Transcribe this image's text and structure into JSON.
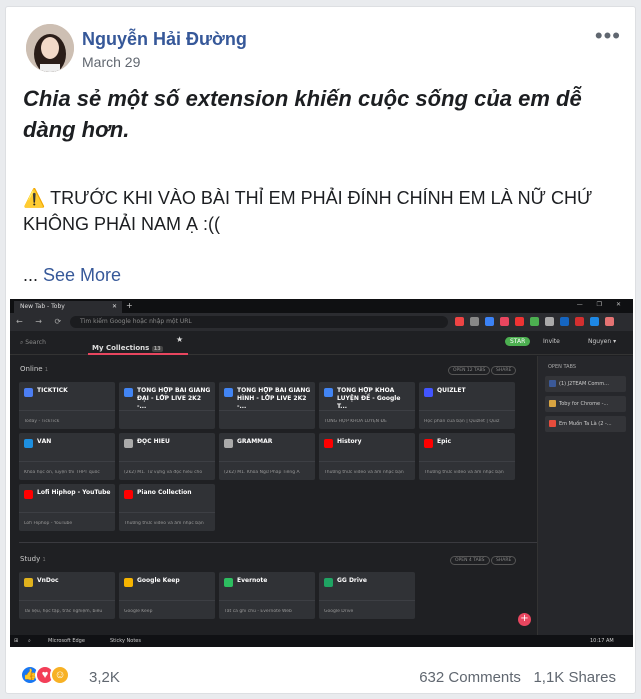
{
  "post": {
    "author": "Nguyễn Hải Đường",
    "date": "March 29",
    "more_icon": "ellipsis-icon",
    "headline": "Chia sẻ một số extension khiến cuộc sống của em dễ dàng hơn.",
    "warning_icon": "⚠️",
    "warning_text": "TRƯỚC KHI VÀO BÀI THỈ EM PHẢI ĐÍNH CHÍNH EM LÀ NỮ CHỨ KHÔNG PHẢI NAM Ạ :((",
    "see_more_prefix": "... ",
    "see_more": "See More"
  },
  "screenshot": {
    "tab_title": "New Tab - Toby",
    "url_placeholder": "Tìm kiếm Google hoặc nhập một URL",
    "search": "Search",
    "my_collections": "My Collections",
    "my_collections_count": "13",
    "invite": "Invite",
    "star_button": "STAR",
    "user": "Nguyen",
    "open_tabs_title": "OPEN TABS",
    "open_tabs": [
      {
        "label": "(1) J2TEAM Comm...",
        "color": "#3b5998"
      },
      {
        "label": "Toby for Chrome -...",
        "color": "#d9a441"
      },
      {
        "label": "Em Muốn Ta Là (2 -...",
        "color": "#e74c3c"
      }
    ],
    "sections": [
      {
        "name": "Online",
        "count": "1",
        "open_label": "OPEN 12 TABS",
        "share_label": "SHARE",
        "cards": [
          {
            "title": "TICKTICK",
            "sub": "Today - TickTick",
            "color": "#4c7ef3"
          },
          {
            "title": "TỔNG HỢP BÀI GIẢNG ĐẠI - LỚP LIVE 2K2 -...",
            "sub": "",
            "color": "#4285f4"
          },
          {
            "title": "TỔNG HỢP BÀI GIẢNG HÌNH - LỚP LIVE 2K2 -...",
            "sub": "",
            "color": "#4285f4"
          },
          {
            "title": "TỔNG HỢP KHÓA LUYỆN ĐỀ - Google T...",
            "sub": "TỔNG HỢP KHÓA LUYỆN ĐỀ",
            "color": "#4285f4"
          },
          {
            "title": "QUIZLET",
            "sub": "Học phần của bạn | Quizlet | Quiz",
            "color": "#4255ff"
          },
          {
            "title": "VĂN",
            "sub": "Khóa học ôn, luyện thi THPT quốc",
            "color": "#1d8fe0"
          },
          {
            "title": "ĐỌC HIỂU",
            "sub": "(2k2) M1. Từ vựng và đọc hiểu cho",
            "color": "#aaaaaa"
          },
          {
            "title": "GRAMMAR",
            "sub": "(2k2) M1. Khóa Ngữ Pháp Tiếng A",
            "color": "#aaaaaa"
          },
          {
            "title": "History",
            "sub": "Thưởng thức video và âm nhạc bạn",
            "color": "#ff0000"
          },
          {
            "title": "Epic",
            "sub": "Thưởng thức video và âm nhạc bạn",
            "color": "#ff0000"
          },
          {
            "title": "Lofi Hiphop - YouTube",
            "sub": "Lofi Hiphop - YouTube",
            "color": "#ff0000"
          },
          {
            "title": "Piano Collection",
            "sub": "Thưởng thức video và âm nhạc bạn",
            "color": "#ff0000"
          }
        ]
      },
      {
        "name": "Study",
        "count": "1",
        "open_label": "OPEN 4 TABS",
        "share_label": "SHARE",
        "cards": [
          {
            "title": "VnDoc",
            "sub": "Tài liệu, học tập, trắc nghiệm, biểu",
            "color": "#e0b21d"
          },
          {
            "title": "Google Keep",
            "sub": "Google Keep",
            "color": "#f6b400"
          },
          {
            "title": "Evernote",
            "sub": "Tất cả ghi chú - Evernote Web",
            "color": "#2dbe60"
          },
          {
            "title": "GG Drive",
            "sub": "Google Drive",
            "color": "#1fa463"
          }
        ]
      }
    ],
    "taskbar_apps": [
      "Microsoft Edge",
      "Sticky Notes"
    ],
    "time": "10:17 AM"
  },
  "reactions": {
    "icons": [
      "like-icon",
      "love-icon",
      "haha-icon"
    ],
    "count": "3,2K",
    "comments": "632 Comments",
    "shares": "1,1K Shares"
  },
  "colors": {
    "link": "#365899",
    "accent": "#e8465f",
    "like": "#1877f2",
    "love": "#f33e58",
    "haha": "#f7b125"
  }
}
